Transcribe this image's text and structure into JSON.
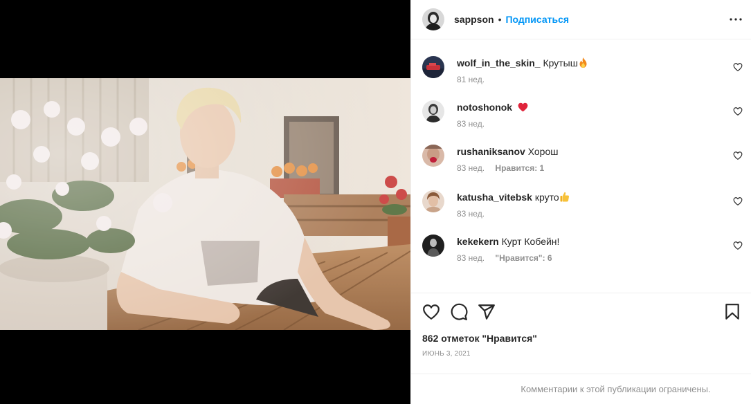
{
  "post": {
    "author": "sappson",
    "separator": "•",
    "follow_label": "Подписаться",
    "more_icon": "more-horizontal-icon",
    "likes_text": "862 отметок \"Нравится\"",
    "date_text": "ИЮНЬ 3, 2021",
    "comments_restricted": "Комментарии к этой публикации ограничены."
  },
  "comments": [
    {
      "user": "wolf_in_the_skin_",
      "text": "Крутыш",
      "emoji": "fire-emoji",
      "age": "81 нед.",
      "likes": ""
    },
    {
      "user": "notoshonok",
      "text": "",
      "emoji": "red-heart-emoji",
      "age": "83 нед.",
      "likes": ""
    },
    {
      "user": "rushaniksanov",
      "text": "Хорош",
      "emoji": "",
      "age": "83 нед.",
      "likes": "Нравится: 1"
    },
    {
      "user": "katusha_vitebsk",
      "text": "круто",
      "emoji": "thumbs-up-emoji",
      "age": "83 нед.",
      "likes": ""
    },
    {
      "user": "kekekern",
      "text": "Курт Кобейн!",
      "emoji": "",
      "age": "83 нед.",
      "likes": "\"Нравится\": 6"
    }
  ],
  "actions": {
    "like_icon": "heart-outline-icon",
    "comment_icon": "comment-icon",
    "share_icon": "paper-plane-icon",
    "save_icon": "bookmark-icon"
  },
  "colors": {
    "link_blue": "#0095f6",
    "secondary_text": "#8e8e8e",
    "border": "#efefef",
    "heart_red": "#ed4956"
  }
}
